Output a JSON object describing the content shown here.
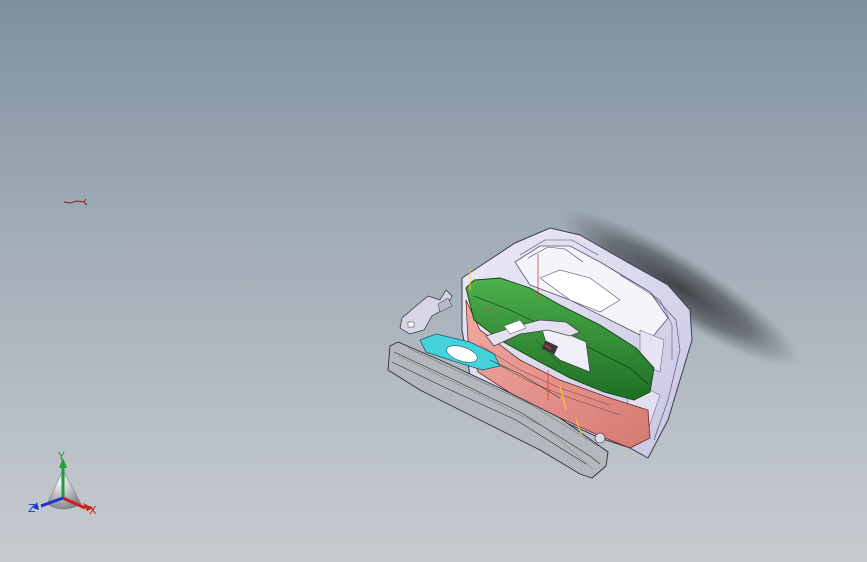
{
  "viewport": {
    "background_top": "#7d8f9e",
    "background_bottom": "#c6cbd0"
  },
  "model": {
    "colors": {
      "body_panel": "#d9d8ee",
      "green_trim": "#2f8a32",
      "salmon_trim": "#e5918a",
      "cyan_part": "#45d2dc",
      "grey_rail": "#9aa0a6",
      "origin_marker": "#e53b2c",
      "point_marker": "#ffd21a"
    }
  },
  "triad": {
    "y_label": "Y",
    "z_label": "Z",
    "x_label": "X",
    "colors": {
      "y": "#1f9d3a",
      "z": "#2233cc",
      "x": "#cc1f1f"
    }
  },
  "sketch_icon": "sketch-curve-icon"
}
